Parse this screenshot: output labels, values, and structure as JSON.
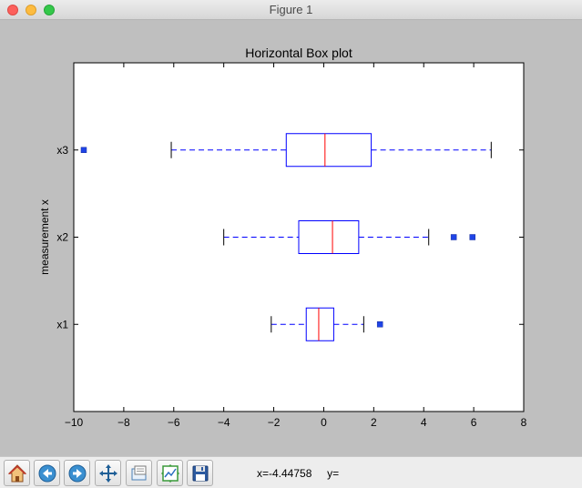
{
  "window": {
    "title": "Figure 1"
  },
  "toolbar": {
    "buttons": [
      {
        "name": "home-button",
        "icon": "home-icon"
      },
      {
        "name": "back-button",
        "icon": "back-arrow-icon"
      },
      {
        "name": "forward-button",
        "icon": "forward-arrow-icon"
      },
      {
        "name": "pan-button",
        "icon": "move-arrows-icon"
      },
      {
        "name": "zoom-button",
        "icon": "zoom-rectangle-icon"
      },
      {
        "name": "subplots-button",
        "icon": "configure-subplots-icon"
      },
      {
        "name": "save-button",
        "icon": "floppy-disk-icon"
      }
    ],
    "x_readout": "x=-4.44758",
    "y_readout": "y="
  },
  "chart_data": {
    "type": "box",
    "orientation": "horizontal",
    "title": "Horizontal Box plot",
    "xlabel": "",
    "ylabel": "measurement x",
    "xlim": [
      -10,
      8
    ],
    "xticks": [
      -10,
      -8,
      -6,
      -4,
      -2,
      0,
      2,
      4,
      6,
      8
    ],
    "xtick_labels": [
      "−10",
      "−8",
      "−6",
      "−4",
      "−2",
      "0",
      "2",
      "4",
      "6",
      "8"
    ],
    "categories": [
      "x1",
      "x2",
      "x3"
    ],
    "boxes": [
      {
        "label": "x1",
        "whisker_low": -2.1,
        "q1": -0.7,
        "median": -0.2,
        "q3": 0.4,
        "whisker_high": 1.6,
        "outliers": [
          2.25
        ]
      },
      {
        "label": "x2",
        "whisker_low": -4.0,
        "q1": -1.0,
        "median": 0.35,
        "q3": 1.4,
        "whisker_high": 4.2,
        "outliers": [
          5.2,
          5.95
        ]
      },
      {
        "label": "x3",
        "whisker_low": -6.1,
        "q1": -1.5,
        "median": 0.05,
        "q3": 1.9,
        "whisker_high": 6.7,
        "outliers": [
          -9.6
        ]
      }
    ],
    "colors": {
      "box": "#0000ff",
      "median": "#ff0000",
      "whisker": "#0000ff",
      "cap": "#000000",
      "outlier": "#1f44e6"
    },
    "grid": false
  }
}
